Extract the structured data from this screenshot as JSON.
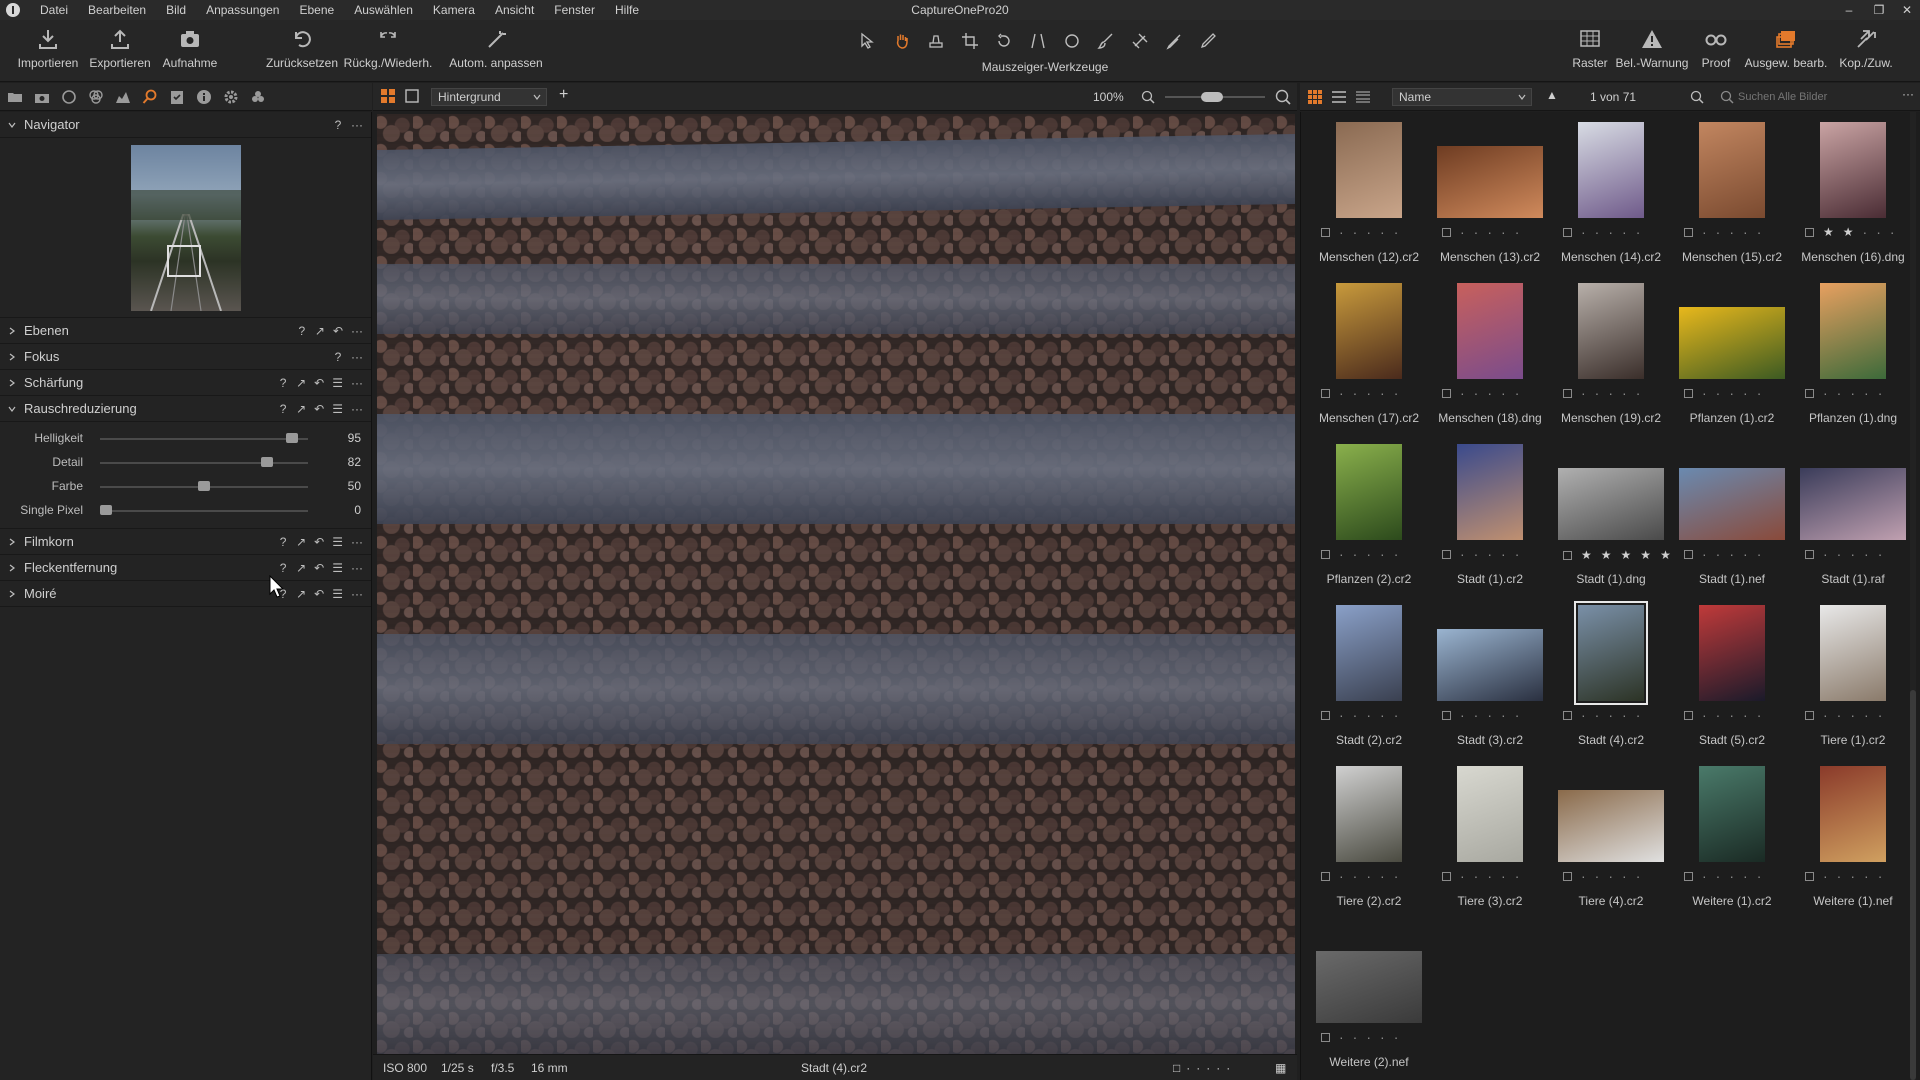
{
  "menu": {
    "items": [
      "Datei",
      "Bearbeiten",
      "Bild",
      "Anpassungen",
      "Ebene",
      "Auswählen",
      "Kamera",
      "Ansicht",
      "Fenster",
      "Hilfe"
    ],
    "window_title": "CaptureOnePro20"
  },
  "toolbar": {
    "left_buttons": [
      {
        "label": "Importieren",
        "icon": "import-icon"
      },
      {
        "label": "Exportieren",
        "icon": "export-icon"
      },
      {
        "label": "Aufnahme",
        "icon": "camera-icon"
      },
      {
        "label": "Zurücksetzen",
        "icon": "reset-icon"
      },
      {
        "label": "Rückg./Wiederh.",
        "icon": "undo-redo-icon"
      },
      {
        "label": "Autom. anpassen",
        "icon": "magic-wand-icon"
      }
    ],
    "cursor_tools_label": "Mauszeiger-Werkzeuge",
    "right_buttons": [
      {
        "label": "Raster",
        "icon": "grid-icon"
      },
      {
        "label": "Bel.-Warnung",
        "icon": "warning-icon"
      },
      {
        "label": "Proof",
        "icon": "proof-glasses-icon"
      },
      {
        "label": "Ausgew. bearb.",
        "icon": "edit-selected-icon"
      },
      {
        "label": "Kop./Zuw.",
        "icon": "copy-apply-icon"
      }
    ]
  },
  "left_panel": {
    "navigator_title": "Navigator",
    "sections": [
      {
        "title": "Ebenen",
        "expanded": false
      },
      {
        "title": "Fokus",
        "expanded": false
      },
      {
        "title": "Schärfung",
        "expanded": false
      },
      {
        "title": "Rauschreduzierung",
        "expanded": true
      },
      {
        "title": "Filmkorn",
        "expanded": false
      },
      {
        "title": "Fleckentfernung",
        "expanded": false
      },
      {
        "title": "Moiré",
        "expanded": false
      }
    ],
    "noise_sliders": [
      {
        "label": "Helligkeit",
        "value": "95",
        "fraction": 0.95
      },
      {
        "label": "Detail",
        "value": "82",
        "fraction": 0.82
      },
      {
        "label": "Farbe",
        "value": "50",
        "fraction": 0.5
      },
      {
        "label": "Single Pixel",
        "value": "0",
        "fraction": 0.0
      }
    ]
  },
  "viewer": {
    "layer_dropdown": "Hintergrund",
    "zoom": "100%",
    "status": {
      "iso": "ISO 800",
      "shutter": "1/25 s",
      "aperture": "f/3.5",
      "focal": "16 mm",
      "filename": "Stadt (4).cr2"
    }
  },
  "browser": {
    "sort_dropdown": "Name",
    "count": "1 von 71",
    "search_placeholder": "Suchen Alle Bilder",
    "thumbnails": [
      {
        "name": "Menschen (12).cr2",
        "stars": 0,
        "colors": [
          "#8a6a52",
          "#c9a58a"
        ],
        "orient": "portrait"
      },
      {
        "name": "Menschen (13).cr2",
        "stars": 0,
        "colors": [
          "#6e3c22",
          "#d08a5c"
        ],
        "orient": "landscape"
      },
      {
        "name": "Menschen (14).cr2",
        "stars": 0,
        "colors": [
          "#d8dce4",
          "#6f5a8a"
        ],
        "orient": "portrait"
      },
      {
        "name": "Menschen (15).cr2",
        "stars": 0,
        "colors": [
          "#c28660",
          "#7a4a30"
        ],
        "orient": "portrait"
      },
      {
        "name": "Menschen (16).dng",
        "stars": 2,
        "colors": [
          "#caa4a4",
          "#4a2c34"
        ],
        "orient": "portrait"
      },
      {
        "name": "Menschen (17).cr2",
        "stars": 0,
        "colors": [
          "#c89a3c",
          "#4a2a1c"
        ],
        "orient": "portrait"
      },
      {
        "name": "Menschen (18).dng",
        "stars": 0,
        "colors": [
          "#c8605c",
          "#7a4c8c"
        ],
        "orient": "portrait"
      },
      {
        "name": "Menschen (19).cr2",
        "stars": 0,
        "colors": [
          "#b8b0aa",
          "#3a2e2a"
        ],
        "orient": "portrait"
      },
      {
        "name": "Pflanzen (1).cr2",
        "stars": 0,
        "colors": [
          "#e8b81c",
          "#3c5a22"
        ],
        "orient": "landscape"
      },
      {
        "name": "Pflanzen (1).dng",
        "stars": 0,
        "colors": [
          "#e8a060",
          "#3c6a3a"
        ],
        "orient": "portrait"
      },
      {
        "name": "Pflanzen (2).cr2",
        "stars": 0,
        "colors": [
          "#8ab04c",
          "#2c4a1c"
        ],
        "orient": "portrait"
      },
      {
        "name": "Stadt (1).cr2",
        "stars": 0,
        "colors": [
          "#3a4a8c",
          "#c09070"
        ],
        "orient": "portrait"
      },
      {
        "name": "Stadt (1).dng",
        "stars": 5,
        "colors": [
          "#b0b0b0",
          "#4a4a4a"
        ],
        "orient": "landscape"
      },
      {
        "name": "Stadt (1).nef",
        "stars": 0,
        "colors": [
          "#6a8ab0",
          "#8a4a3a"
        ],
        "orient": "landscape"
      },
      {
        "name": "Stadt (1).raf",
        "stars": 0,
        "colors": [
          "#3a3c5a",
          "#c0a0b0"
        ],
        "orient": "landscape"
      },
      {
        "name": "Stadt (2).cr2",
        "stars": 0,
        "colors": [
          "#8aa0c8",
          "#3a4050"
        ],
        "orient": "portrait"
      },
      {
        "name": "Stadt (3).cr2",
        "stars": 0,
        "colors": [
          "#9ab4d0",
          "#2a3040"
        ],
        "orient": "landscape"
      },
      {
        "name": "Stadt (4).cr2",
        "stars": 0,
        "colors": [
          "#7a90a8",
          "#2c3325"
        ],
        "orient": "portrait",
        "selected": true
      },
      {
        "name": "Stadt (5).cr2",
        "stars": 0,
        "colors": [
          "#c03a3a",
          "#1a1a2a"
        ],
        "orient": "portrait"
      },
      {
        "name": "Tiere (1).cr2",
        "stars": 0,
        "colors": [
          "#e8e8e8",
          "#8a7a6a"
        ],
        "orient": "portrait"
      },
      {
        "name": "Tiere (2).cr2",
        "stars": 0,
        "colors": [
          "#d0d0d0",
          "#4a4a40"
        ],
        "orient": "portrait"
      },
      {
        "name": "Tiere (3).cr2",
        "stars": 0,
        "colors": [
          "#d8d8d0",
          "#a8a8a0"
        ],
        "orient": "portrait"
      },
      {
        "name": "Tiere (4).cr2",
        "stars": 0,
        "colors": [
          "#8a6a4a",
          "#e0e0e0"
        ],
        "orient": "landscape"
      },
      {
        "name": "Weitere (1).cr2",
        "stars": 0,
        "colors": [
          "#4a7a6a",
          "#1a2a24"
        ],
        "orient": "portrait"
      },
      {
        "name": "Weitere (1).nef",
        "stars": 0,
        "colors": [
          "#8a3a2a",
          "#d0a060"
        ],
        "orient": "portrait"
      },
      {
        "name": "Weitere (2).nef",
        "stars": 0,
        "colors": [
          "#6a6a6a",
          "#3a3a3a"
        ],
        "orient": "landscape"
      }
    ]
  },
  "accent": "#e37a2c"
}
